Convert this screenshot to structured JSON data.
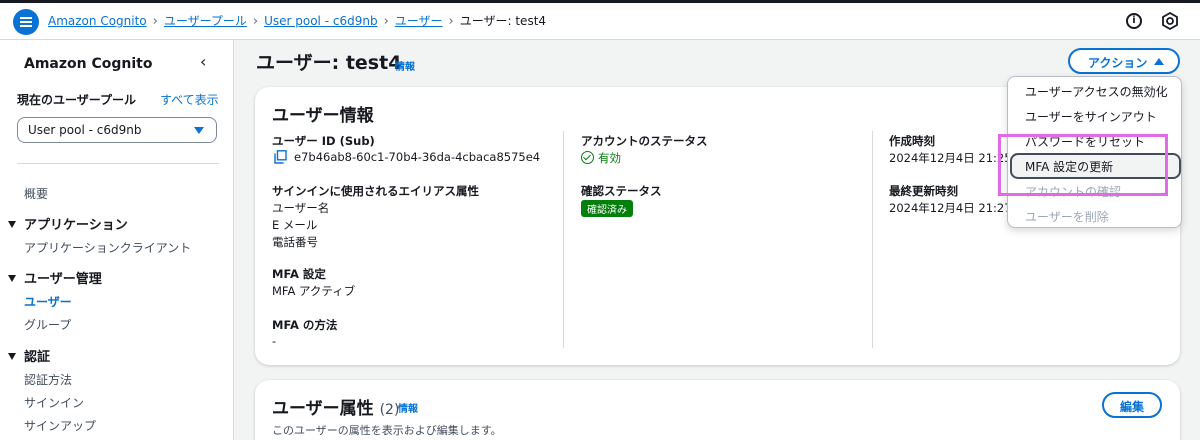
{
  "breadcrumb": {
    "items": [
      "Amazon Cognito",
      "ユーザープール",
      "User pool - c6d9nb",
      "ユーザー"
    ],
    "current": "ユーザー: test4"
  },
  "sidebar": {
    "title": "Amazon Cognito",
    "pool_label": "現在のユーザープール",
    "show_all": "すべて表示",
    "selected_pool": "User pool - c6d9nb",
    "overview": "概要",
    "sections": [
      {
        "label": "アプリケーション",
        "items": [
          "アプリケーションクライアント"
        ]
      },
      {
        "label": "ユーザー管理",
        "items": [
          "ユーザー",
          "グループ"
        ]
      },
      {
        "label": "認証",
        "items": [
          "認証方法",
          "サインイン",
          "サインアップ"
        ]
      }
    ]
  },
  "page": {
    "title": "ユーザー: test4",
    "info": "情報",
    "actions_label": "アクション"
  },
  "user_info": {
    "title": "ユーザー情報",
    "user_id_label": "ユーザー ID (Sub)",
    "user_id_value": "e7b46ab8-60c1-70b4-36da-4cbaca8575e4",
    "alias_label": "サインインに使用されるエイリアス属性",
    "alias_values": [
      "ユーザー名",
      "E メール",
      "電話番号"
    ],
    "mfa_label": "MFA 設定",
    "mfa_value": "MFA アクティブ",
    "mfa_method_label": "MFA の方法",
    "mfa_method_value": "-",
    "account_status_label": "アカウントのステータス",
    "account_status_value": "有効",
    "confirm_status_label": "確認ステータス",
    "confirm_status_value": "確認済み",
    "created_label": "作成時刻",
    "created_value": "2024年12月4日 21:25",
    "updated_label": "最終更新時刻",
    "updated_value": "2024年12月4日 21:27"
  },
  "attributes": {
    "title": "ユーザー属性",
    "count": "(2)",
    "info": "情報",
    "description": "このユーザーの属性を表示および編集します。",
    "edit_label": "編集"
  },
  "action_menu": {
    "items": [
      {
        "label": "ユーザーアクセスの無効化",
        "disabled": false
      },
      {
        "label": "ユーザーをサインアウト",
        "disabled": false
      },
      {
        "label": "パスワードをリセット",
        "disabled": false
      },
      {
        "label": "MFA 設定の更新",
        "disabled": false
      },
      {
        "label": "アカウントの確認",
        "disabled": true
      },
      {
        "label": "ユーザーを削除",
        "disabled": true
      }
    ]
  },
  "colors": {
    "accent": "#0972d3",
    "success": "#037f0c",
    "highlight": "#e36ae6"
  }
}
